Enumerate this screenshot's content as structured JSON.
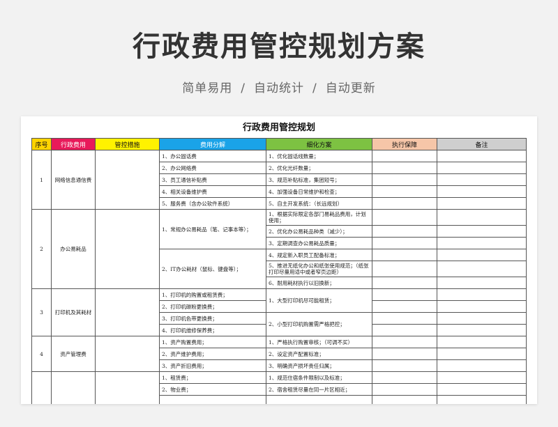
{
  "hero": {
    "title": "行政费用管控规划方案",
    "tags": [
      "简单易用",
      "自动统计",
      "自动更新"
    ],
    "separator": "/"
  },
  "sheet": {
    "title": "行政费用管控规划",
    "headers": {
      "index": "序号",
      "category": "行政费用",
      "measures": "管控措施",
      "split": "费用分解",
      "plan": "细化方案",
      "guarantee": "执行保障",
      "note": "备注"
    },
    "header_colors": {
      "index": "#ffd400",
      "category": "#e8195a",
      "measures": "#fff200",
      "split": "#1aa3e8",
      "plan": "#7dc242",
      "guarantee": "#f6c6a8",
      "note": "#cfcfcf"
    },
    "groups": [
      {
        "index": "1",
        "category": "网络信息通信费",
        "splits": [
          "1、办公固话费",
          "2、办公网络费",
          "3、员工通信补贴费",
          "4、相关设备维护费",
          "5、服务费（含办公软件系统）"
        ],
        "plans": [
          "1、优化固话线数量；",
          "2、优化光纤数量；",
          "3、规范补贴标准，集团短号；",
          "4、加强设备日常维护和检查；",
          "5、自主开发系统：（长远规划）"
        ]
      },
      {
        "index": "2",
        "category": "办公易耗品",
        "split_a": "1、常规办公易耗品（笔、记事本等）；",
        "split_b": "2、IT办公耗材（鼠标、键盘等）；",
        "plans": [
          "1、根据实际限定各部门易耗品费用，计划使用；",
          "2、优化办公易耗品种类（减少）；",
          "3、定期调查办公易耗品质量；",
          "4、规定新入职员工配备标准；",
          "5、推进无纸化办公和纸张使用规范；（纸张打印尽量用适中或者窄页边距）",
          "6、耐用耗材执行以旧换新；"
        ]
      },
      {
        "index": "3",
        "category": "打印机及其耗材",
        "splits": [
          "1、打印机的购置或租赁费；",
          "2、打印机碳粉更换费；",
          "3、打印机色带更换费；",
          "4、打印机维修保养费；"
        ],
        "plan_a": "1、大型打印机尽可能租赁；",
        "plan_b": "2、小型打印机购置需严格把控；"
      },
      {
        "index": "4",
        "category": "资产管理费",
        "splits": [
          "1、资产购置费用；",
          "2、资产维护费用；",
          "3、资产折旧费用；"
        ],
        "plans": [
          "1、严格执行购置审核；（可调不买）",
          "2、设定资产配置标准；",
          "3、明确资产损坏责任归属；"
        ]
      },
      {
        "index": "",
        "category": "",
        "splits": [
          "1、租赁费；",
          "2、物业费；"
        ],
        "plans": [
          "1、规范住宿条件限制以及标准；",
          "2、宿舍租赁尽量在同一片区相近；"
        ]
      }
    ]
  }
}
